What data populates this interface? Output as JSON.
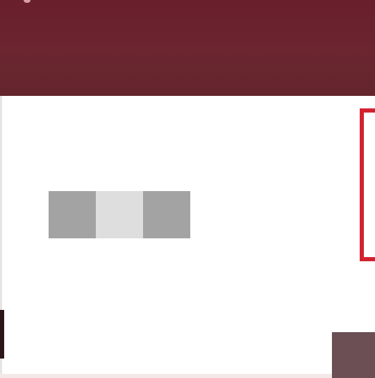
{
  "colors": {
    "header_background": "#6b2630",
    "content_background": "#ffffff",
    "accent_frame": "#d3222f",
    "corner_tile": "#6b4f55",
    "loading_dark": "#a3a3a3",
    "loading_light": "#dedede"
  },
  "loading_indicator": {
    "active_squares": [
      true,
      false,
      true
    ]
  }
}
